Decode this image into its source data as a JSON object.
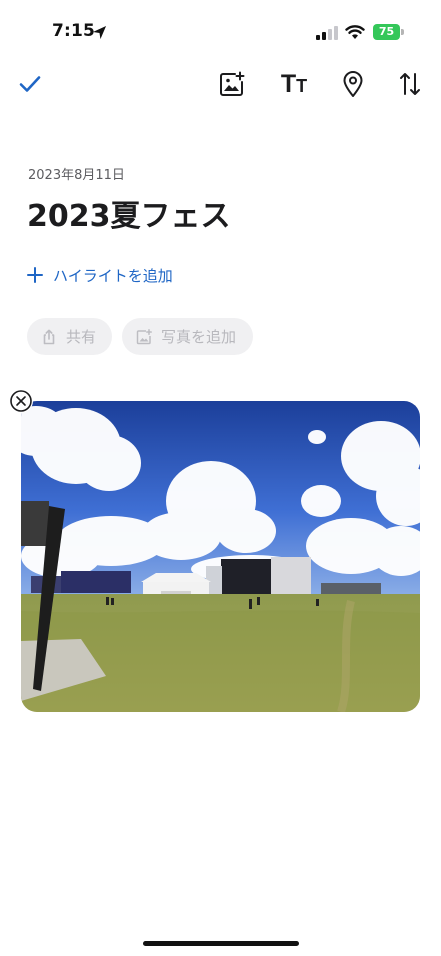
{
  "status_bar": {
    "time": "7:15",
    "battery_level": "75",
    "battery_color": "#34c759",
    "icons": [
      "location-arrow-icon",
      "cellular-signal-icon",
      "wifi-icon",
      "battery-icon"
    ]
  },
  "toolbar": {
    "icons": [
      "checkmark-icon",
      "add-photo-icon",
      "text-format-icon",
      "location-pin-icon",
      "sort-arrows-icon"
    ],
    "text_format_glyph_large": "T",
    "text_format_glyph_small": "T",
    "accent_color": "#1f66c5"
  },
  "entry": {
    "date": "2023年8月11日",
    "title": "2023夏フェス",
    "add_highlight_label": "ハイライトを追加"
  },
  "actions": {
    "share_label": "共有",
    "add_photo_label": "写真を追加"
  },
  "photo": {
    "description_icon": "remove-photo-icon",
    "scene": "outdoor-festival-field-photo"
  }
}
